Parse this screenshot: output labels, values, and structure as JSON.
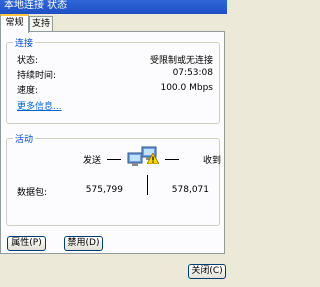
{
  "window": {
    "title": "本地连接 状态"
  },
  "tabs": [
    {
      "label": "常规"
    },
    {
      "label": "支持"
    }
  ],
  "connection": {
    "group_label": "连接",
    "status_label": "状态:",
    "status_value": "受限制或无连接",
    "duration_label": "持续时间:",
    "duration_value": "07:53:08",
    "speed_label": "速度:",
    "speed_value": "100.0 Mbps",
    "more_info_link": "更多信息..."
  },
  "activity": {
    "group_label": "活动",
    "sent_label": "发送",
    "received_label": "收到",
    "packets_label": "数据包:",
    "packets_sent": "575,799",
    "packets_received": "578,071"
  },
  "buttons": {
    "properties": "属性(P)",
    "disable": "禁用(D)",
    "close": "关闭(C)"
  }
}
